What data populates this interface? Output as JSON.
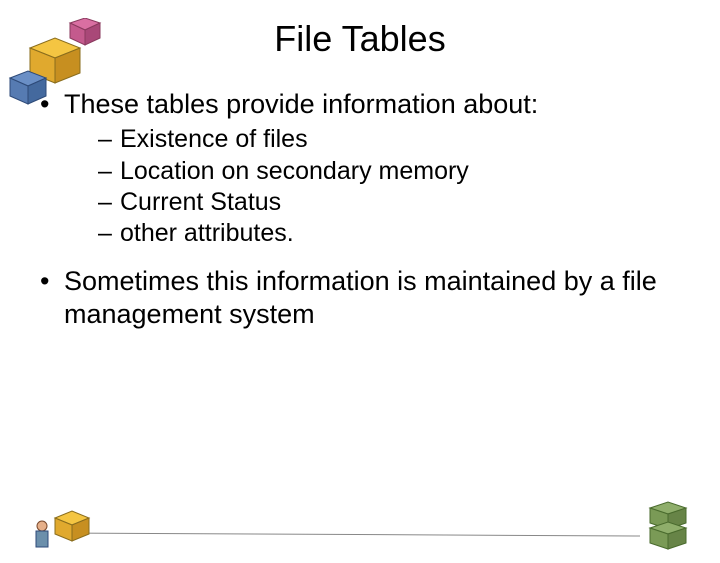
{
  "title": "File Tables",
  "bullets": [
    {
      "text": "These tables provide information about:",
      "sub": [
        "Existence of files",
        "Location on secondary memory",
        "Current Status",
        "other attributes."
      ]
    },
    {
      "text": "Sometimes this information is maintained by a file management system",
      "sub": []
    }
  ]
}
